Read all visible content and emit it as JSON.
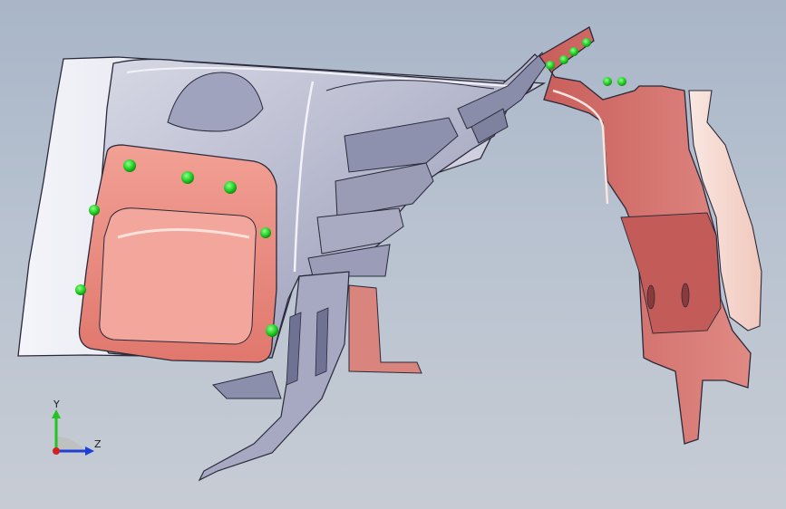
{
  "view": {
    "background_top": "#a9b6c8",
    "background_bottom": "#c7ccd4"
  },
  "model": {
    "left_body_color": "#b4b6cc",
    "highlight_color": "#e9eaf2",
    "left_panel_color": "#ef8a80",
    "right_bracket_color": "#d96e6a",
    "right_flange_color": "#f6d7cf",
    "weld_point_color": "#22cc22"
  },
  "triad": {
    "y_label": "Y",
    "z_label": "Z",
    "y_color": "#22c322",
    "z_color": "#1e3fd6",
    "x_color": "#d12222"
  }
}
